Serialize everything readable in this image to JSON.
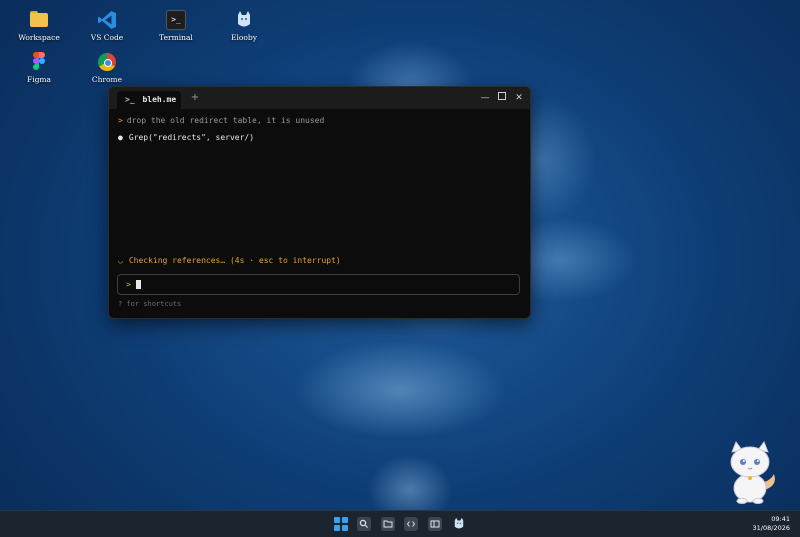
{
  "desktop": {
    "icons": [
      {
        "label": "Workspace",
        "icon": "folder-icon"
      },
      {
        "label": "VS Code",
        "icon": "vscode-icon"
      },
      {
        "label": "Terminal",
        "icon": "terminal-icon"
      },
      {
        "label": "Elooby",
        "icon": "elooby-icon"
      },
      {
        "label": "Figma",
        "icon": "figma-icon"
      },
      {
        "label": "Chrome",
        "icon": "chrome-icon"
      }
    ]
  },
  "terminal": {
    "tab_prompt": ">_",
    "tab_title": "bleh.me",
    "new_tab": "+",
    "controls": {
      "minimize": "—",
      "close": "✕"
    },
    "prompt_caret": ">",
    "user_message": "drop the old redirect table, it is unused",
    "tool_bullet": "●",
    "tool_call": "Grep(\"redirects\", server/)",
    "status_spinner": "◡",
    "status_text": "Checking references… (4s · esc to interrupt)",
    "input_caret": ">",
    "hint": "? for shortcuts"
  },
  "taskbar": {
    "items": [
      "start-icon",
      "search-icon",
      "folder-icon",
      "code-icon",
      "panel-icon",
      "elooby-icon"
    ],
    "time": "09:41",
    "date": "31/08/2026"
  },
  "colors": {
    "accent": "#e8a02f",
    "terminal_bg": "#0c0c0c",
    "taskbar_bg": "#1b2530",
    "wallpaper": "#1f5c9c"
  }
}
